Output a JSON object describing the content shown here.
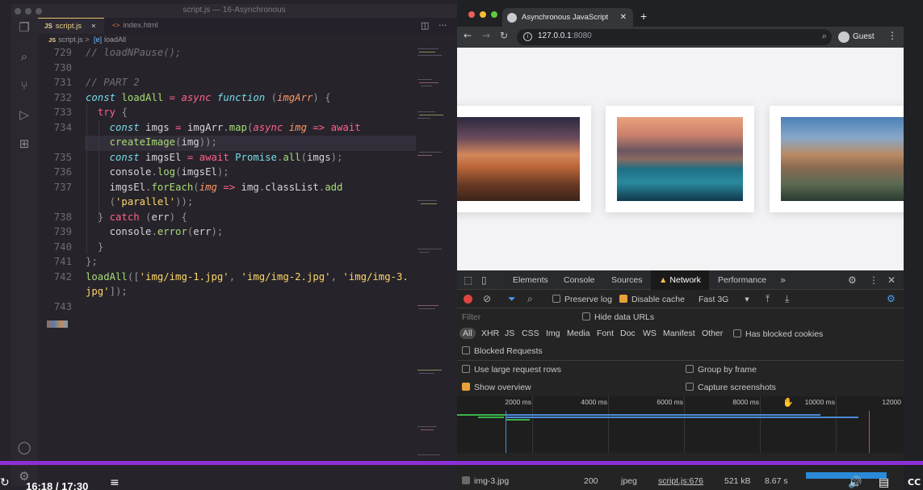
{
  "editor": {
    "window_title": "script.js — 16-Asynchronous",
    "tabs": [
      {
        "badge": "JS",
        "label": "script.js",
        "close": "×"
      },
      {
        "badge": "<>",
        "label": "index.html"
      }
    ],
    "breadcrumb": {
      "badge": "JS",
      "file": "script.js",
      "sep": ">",
      "symbol_icon": "[e]",
      "symbol": "loadAll"
    },
    "line_numbers": [
      "729",
      "730",
      "731",
      "732",
      "733",
      "734",
      "",
      "735",
      "736",
      "737",
      "",
      "738",
      "739",
      "740",
      "741",
      "742",
      "",
      "743"
    ]
  },
  "browser": {
    "tab_title": "Asynchronous JavaScript",
    "url_host": "127.0.0.1",
    "url_port": ":8080",
    "profile": "Guest"
  },
  "devtools": {
    "tabs": [
      "Elements",
      "Console",
      "Sources",
      "Network",
      "Performance"
    ],
    "active_tab": "Network",
    "toolbar": {
      "preserve_log": "Preserve log",
      "disable_cache": "Disable cache",
      "throttle": "Fast 3G"
    },
    "filter_placeholder": "Filter",
    "hide_data_urls": "Hide data URLs",
    "type_filters": [
      "All",
      "XHR",
      "JS",
      "CSS",
      "Img",
      "Media",
      "Font",
      "Doc",
      "WS",
      "Manifest",
      "Other"
    ],
    "has_blocked_cookies": "Has blocked cookies",
    "blocked_requests": "Blocked Requests",
    "options": {
      "large_rows": "Use large request rows",
      "group_by_frame": "Group by frame",
      "show_overview": "Show overview",
      "capture_screenshots": "Capture screenshots"
    },
    "timeline_ticks": [
      "2000 ms",
      "4000 ms",
      "6000 ms",
      "8000 ms",
      "10000 ms",
      "12000"
    ],
    "request": {
      "name": "img-3.jpg",
      "status": "200",
      "type": "jpeg",
      "initiator": "script.js:676",
      "size": "521 kB",
      "time": "8.67 s"
    }
  },
  "video": {
    "time": "16:18 / 17:30",
    "progress": 0.93
  }
}
